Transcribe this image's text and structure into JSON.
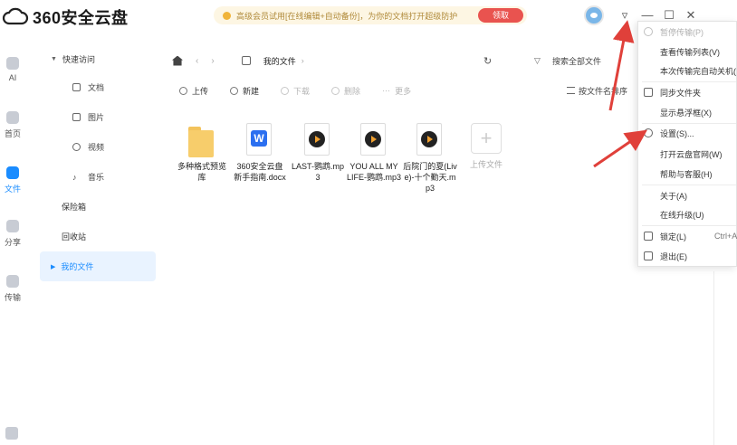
{
  "app": {
    "brand": "360安全云盘"
  },
  "promo": {
    "text": "高级会员试用[在线编辑+自动备份]，为你的文档打开超级防护",
    "button": "领取"
  },
  "window": {
    "minimize": "—",
    "maximize": "☐",
    "close": "✕",
    "menu_toggle": "▿"
  },
  "rail": [
    {
      "icon": "ai-icon",
      "label": "AI"
    },
    {
      "icon": "home-icon",
      "label": "首页"
    },
    {
      "icon": "folder-icon",
      "label": "文件",
      "active": true
    },
    {
      "icon": "share-icon",
      "label": "分享"
    },
    {
      "icon": "transfer-icon",
      "label": "传输"
    }
  ],
  "nav": {
    "quick_access": "快速访问",
    "subs": [
      "文档",
      "图片",
      "视频",
      "音乐"
    ],
    "safe": "保险箱",
    "recycle": "回收站",
    "my_files": "我的文件"
  },
  "path": {
    "crumb": "我的文件",
    "search_placeholder": "搜索全部文件"
  },
  "actions": {
    "upload": "上传",
    "new": "新建",
    "download": "下载",
    "delete": "删除",
    "more": "更多",
    "sort": "按文件名排序"
  },
  "files": [
    {
      "type": "folder",
      "name": "多种格式预览库"
    },
    {
      "type": "docx",
      "name": "360安全云盘新手指南.docx"
    },
    {
      "type": "mp3",
      "name": "LAST-鹦鹉.mp3"
    },
    {
      "type": "mp3",
      "name": "YOU ALL MY LIFE-鹦鹉.mp3"
    },
    {
      "type": "mp3",
      "name": "后院门的夏(Live)-十个勤天.mp3"
    },
    {
      "type": "upload",
      "name": "上传文件"
    }
  ],
  "menu": {
    "items": [
      {
        "label": "暂停传输(P)",
        "disabled": true,
        "icon": "pause-icon"
      },
      {
        "label": "查看传输列表(V)"
      },
      {
        "label": "本次传输完自动关机(",
        "disabled": false
      },
      {
        "label": "同步文件夹",
        "icon": "sync-icon"
      },
      {
        "label": "显示悬浮框(X)"
      },
      {
        "label": "设置(S)...",
        "icon": "settings-icon",
        "highlight": true
      },
      {
        "label": "打开云盘官网(W)"
      },
      {
        "label": "帮助与客服(H)"
      },
      {
        "label": "关于(A)"
      },
      {
        "label": "在线升级(U)"
      },
      {
        "label": "锁定(L)",
        "shortcut": "Ctrl+A",
        "icon": "lock-icon"
      },
      {
        "label": "退出(E)",
        "icon": "exit-icon"
      }
    ]
  },
  "colors": {
    "accent": "#1a8cff",
    "arrow": "#e0403a",
    "promo_bg": "#fdf6e3"
  }
}
